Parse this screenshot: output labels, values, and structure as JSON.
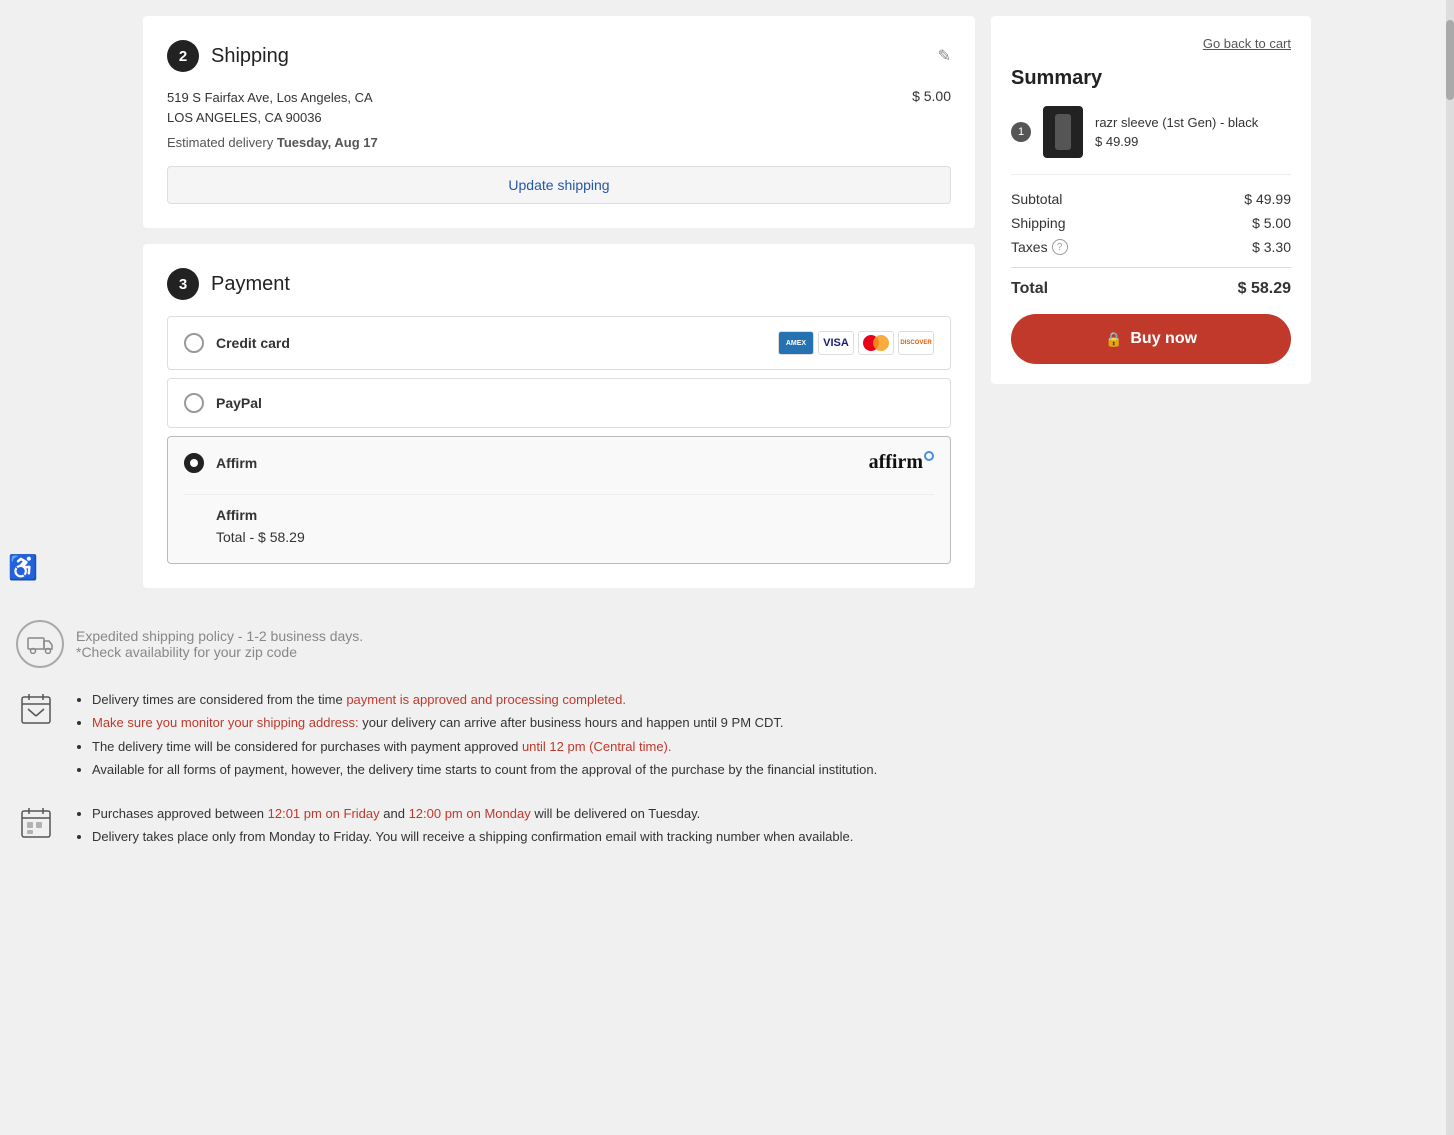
{
  "page": {
    "background": "#f0f0f0"
  },
  "shipping": {
    "step_number": "2",
    "title": "Shipping",
    "address_line1": "519 S Fairfax Ave, Los Angeles, CA",
    "address_line2": "LOS ANGELES, CA 90036",
    "price": "$ 5.00",
    "estimated_label": "Estimated delivery",
    "delivery_date": "Tuesday, Aug 17",
    "update_button_label": "Update shipping"
  },
  "payment": {
    "step_number": "3",
    "title": "Payment",
    "options": [
      {
        "id": "credit-card",
        "label": "Credit card",
        "selected": false,
        "has_card_icons": true
      },
      {
        "id": "paypal",
        "label": "PayPal",
        "selected": false,
        "has_card_icons": false
      },
      {
        "id": "affirm",
        "label": "Affirm",
        "selected": true,
        "has_card_icons": false
      }
    ],
    "affirm_content_title": "Affirm",
    "affirm_total_label": "Total - $ 58.29"
  },
  "summary": {
    "go_back_label": "Go back to cart",
    "title": "Summary",
    "item_count": "1",
    "item_name": "razr sleeve (1st Gen) - black",
    "item_price": "$ 49.99",
    "subtotal_label": "Subtotal",
    "subtotal_value": "$ 49.99",
    "shipping_label": "Shipping",
    "shipping_value": "$ 5.00",
    "taxes_label": "Taxes",
    "taxes_value": "$ 3.30",
    "total_label": "Total",
    "total_value": "$ 58.29",
    "buy_now_label": "Buy now",
    "lock_icon": "🔒"
  },
  "footer": {
    "expedited_title": "Expedited shipping policy - 1-2 business days.",
    "expedited_subtitle": "*Check availability for your zip code",
    "delivery_info": [
      "Delivery times are considered from the time payment is approved and processing completed.",
      "Make sure you monitor your shipping address: your delivery can arrive after business hours and happen until 9 PM CDT.",
      "The delivery time will be considered for purchases with payment approved until 12 pm (Central time).",
      "Available for all forms of payment, however, the delivery time starts to count from the approval of the purchase by the financial institution."
    ],
    "monday_info": [
      "Purchases approved between 12:01 pm on Friday and 12:00 pm on Monday will be delivered on Tuesday.",
      "Delivery takes place only from Monday to Friday. You will receive a shipping confirmation email with tracking number when available."
    ]
  }
}
